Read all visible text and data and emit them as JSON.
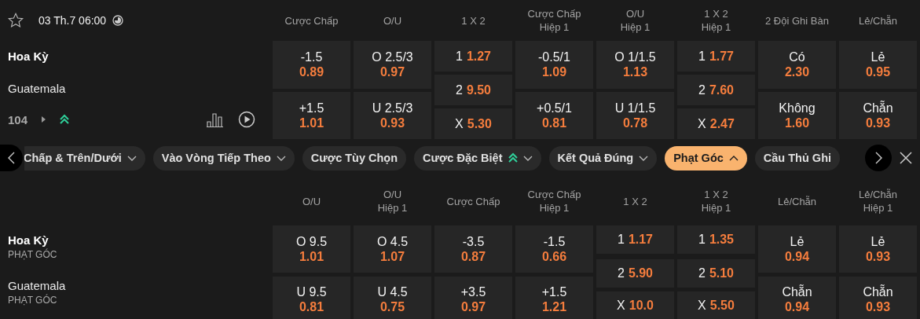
{
  "match": {
    "date": "03 Th.7 06:00",
    "home": "Hoa Kỳ",
    "away": "Guatemala",
    "market_count": "104",
    "columns": [
      {
        "header": [
          "Cược Chấp"
        ],
        "kind": "stacked",
        "cells": [
          {
            "label": "-1.5",
            "odds": "0.89"
          },
          {
            "label": "+1.5",
            "odds": "1.01"
          }
        ]
      },
      {
        "header": [
          "O/U"
        ],
        "kind": "stacked",
        "cells": [
          {
            "label": "O 2.5/3",
            "odds": "0.97"
          },
          {
            "label": "U 2.5/3",
            "odds": "0.93"
          }
        ]
      },
      {
        "header": [
          "1 X 2"
        ],
        "kind": "inline",
        "cells": [
          {
            "label": "1",
            "odds": "1.27"
          },
          {
            "label": "2",
            "odds": "9.50"
          },
          {
            "label": "X",
            "odds": "5.30"
          }
        ]
      },
      {
        "header": [
          "Cược Chấp",
          "Hiệp 1"
        ],
        "kind": "stacked",
        "cells": [
          {
            "label": "-0.5/1",
            "odds": "1.09"
          },
          {
            "label": "+0.5/1",
            "odds": "0.81"
          }
        ]
      },
      {
        "header": [
          "O/U",
          "Hiệp 1"
        ],
        "kind": "stacked",
        "cells": [
          {
            "label": "O 1/1.5",
            "odds": "1.13"
          },
          {
            "label": "U 1/1.5",
            "odds": "0.78"
          }
        ]
      },
      {
        "header": [
          "1 X 2",
          "Hiệp 1"
        ],
        "kind": "inline",
        "cells": [
          {
            "label": "1",
            "odds": "1.77"
          },
          {
            "label": "2",
            "odds": "7.60"
          },
          {
            "label": "X",
            "odds": "2.47"
          }
        ]
      },
      {
        "header": [
          "2 Đội Ghi Bàn"
        ],
        "kind": "stacked",
        "cells": [
          {
            "label": "Có",
            "odds": "2.30"
          },
          {
            "label": "Không",
            "odds": "1.60"
          }
        ]
      },
      {
        "header": [
          "Lẻ/Chẵn"
        ],
        "kind": "stacked",
        "cells": [
          {
            "label": "Lẻ",
            "odds": "0.95"
          },
          {
            "label": "Chẵn",
            "odds": "0.93"
          }
        ]
      }
    ]
  },
  "tabs": [
    {
      "label": "Chấp & Trên/Dưới",
      "has_menu": true,
      "expanded": false,
      "hot": false,
      "selected": false
    },
    {
      "label": "Vào Vòng Tiếp Theo",
      "has_menu": true,
      "expanded": false,
      "hot": false,
      "selected": false
    },
    {
      "label": "Cược Tùy Chọn",
      "has_menu": false,
      "hot": false,
      "selected": false
    },
    {
      "label": "Cược Đặc Biệt",
      "has_menu": true,
      "expanded": false,
      "hot": true,
      "selected": false
    },
    {
      "label": "Kết Quả Đúng",
      "has_menu": true,
      "expanded": false,
      "hot": false,
      "selected": false
    },
    {
      "label": "Phạt Góc",
      "has_menu": true,
      "expanded": true,
      "hot": false,
      "selected": true
    },
    {
      "label": "Cầu Thủ Ghi",
      "has_menu": false,
      "hot": false,
      "selected": false
    }
  ],
  "corners": {
    "home": "Hoa Kỳ",
    "home_sub": "PHẠT GÓC",
    "away": "Guatemala",
    "away_sub": "PHẠT GÓC",
    "columns": [
      {
        "header": [
          "O/U"
        ],
        "kind": "stacked",
        "cells": [
          {
            "label": "O 9.5",
            "odds": "1.01"
          },
          {
            "label": "U 9.5",
            "odds": "0.81"
          }
        ]
      },
      {
        "header": [
          "O/U",
          "Hiệp 1"
        ],
        "kind": "stacked",
        "cells": [
          {
            "label": "O 4.5",
            "odds": "1.07"
          },
          {
            "label": "U 4.5",
            "odds": "0.75"
          }
        ]
      },
      {
        "header": [
          "Cược Chấp"
        ],
        "kind": "stacked",
        "cells": [
          {
            "label": "-3.5",
            "odds": "0.87"
          },
          {
            "label": "+3.5",
            "odds": "0.97"
          }
        ]
      },
      {
        "header": [
          "Cược Chấp",
          "Hiệp 1"
        ],
        "kind": "stacked",
        "cells": [
          {
            "label": "-1.5",
            "odds": "0.66"
          },
          {
            "label": "+1.5",
            "odds": "1.21"
          }
        ]
      },
      {
        "header": [
          "1 X 2"
        ],
        "kind": "inline",
        "cells": [
          {
            "label": "1",
            "odds": "1.17"
          },
          {
            "label": "2",
            "odds": "5.90"
          },
          {
            "label": "X",
            "odds": "10.0"
          }
        ]
      },
      {
        "header": [
          "1 X 2",
          "Hiệp 1"
        ],
        "kind": "inline",
        "cells": [
          {
            "label": "1",
            "odds": "1.35"
          },
          {
            "label": "2",
            "odds": "5.10"
          },
          {
            "label": "X",
            "odds": "5.50"
          }
        ]
      },
      {
        "header": [
          "Lẻ/Chẵn"
        ],
        "kind": "stacked",
        "cells": [
          {
            "label": "Lẻ",
            "odds": "0.94"
          },
          {
            "label": "Chẵn",
            "odds": "0.94"
          }
        ]
      },
      {
        "header": [
          "Lẻ/Chẵn",
          "Hiệp 1"
        ],
        "kind": "stacked",
        "cells": [
          {
            "label": "Lẻ",
            "odds": "0.93"
          },
          {
            "label": "Chẵn",
            "odds": "0.93"
          }
        ]
      }
    ]
  }
}
